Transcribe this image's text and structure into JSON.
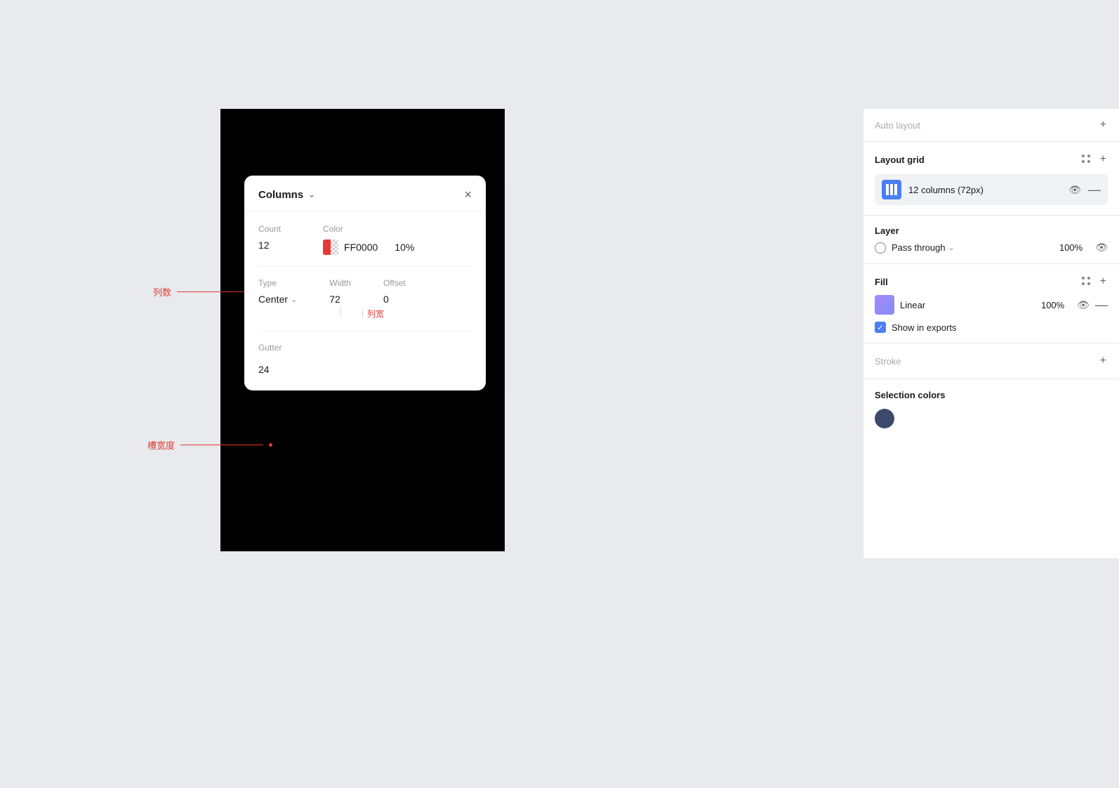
{
  "right_panel": {
    "fade_title": "Auto layout",
    "fade_plus": "+",
    "layout_grid": {
      "title": "Layout grid",
      "grid_item": "12 columns (72px)"
    },
    "layer": {
      "title": "Layer",
      "blend_mode": "Pass through",
      "opacity": "100%"
    },
    "fill": {
      "title": "Fill",
      "label": "Linear",
      "opacity": "100%",
      "show_exports": "Show in exports"
    },
    "stroke": {
      "title": "Stroke"
    },
    "selection_colors": {
      "title": "Selection colors"
    }
  },
  "columns_popup": {
    "title": "Columns",
    "close": "×",
    "count_label": "Count",
    "count_value": "12",
    "color_label": "Color",
    "color_hex": "FF0000",
    "color_opacity": "10%",
    "type_label": "Type",
    "type_value": "Center",
    "width_label": "Width",
    "width_value": "72",
    "offset_label": "Offset",
    "offset_value": "0",
    "gutter_label": "Gutter",
    "gutter_value": "24",
    "col_width_annotation": "列宽",
    "col_count_annotation": "列数",
    "gutter_annotation": "槽宽度"
  }
}
